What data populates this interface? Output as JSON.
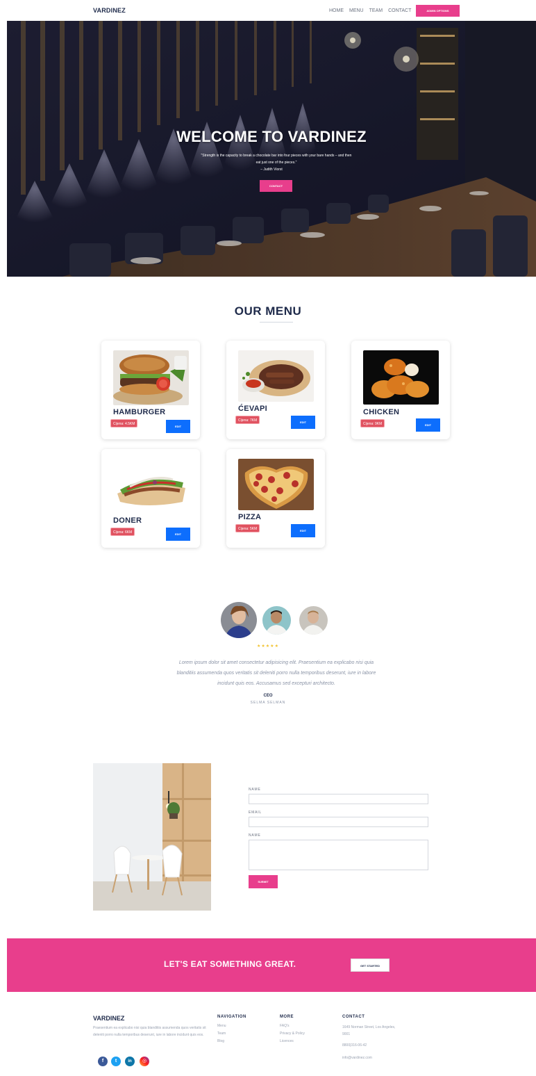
{
  "nav": {
    "brand": "VARDINEZ",
    "links": [
      "HOME",
      "MENU",
      "TEAM",
      "CONTACT"
    ],
    "admin_label": "ADMIN OPTIONS"
  },
  "hero": {
    "title": "WELCOME TO VARDINEZ",
    "quote": "\"Strength is the capacity to break a chocolate bar into four pieces with your bare hands – and then eat just one of the pieces.\"",
    "author": "– Judith Viorst",
    "button": "CONTACT"
  },
  "menu": {
    "title": "OUR MENU",
    "items": [
      {
        "name": "HAMBURGER",
        "price": "Cijena: 4.5KM",
        "edit": "EDIT"
      },
      {
        "name": "ĆEVAPI",
        "price": "Cijena: 7KM",
        "edit": "EDIT"
      },
      {
        "name": "CHICKEN",
        "price": "Cijena: 9KM",
        "edit": "EDIT"
      },
      {
        "name": "DONER",
        "price": "Cijena: 6KM",
        "edit": "EDIT"
      },
      {
        "name": "PIZZA",
        "price": "Cijena: 5KM",
        "edit": "EDIT"
      }
    ]
  },
  "testimonial": {
    "stars": "★★★★★",
    "text": "Lorem ipsum dolor sit amet consectetur adipisicing elit. Praesentium ea explicabo nisi quia blanditiis assumenda quos veritatis sit deleniti porro nulla temporibus deserunt, iure in labore incidunt quis eos. Accusamus sed excepturi architecto.",
    "role": "CEO",
    "name": "SELMA SELMAN"
  },
  "contact": {
    "label_name": "NAME",
    "label_email": "EMAIL",
    "label_message": "NAME",
    "submit": "SUBMIT"
  },
  "cta": {
    "text": "LET'S EAT SOMETHING GREAT.",
    "button": "GET STARTED"
  },
  "footer": {
    "brand": "VARDINEZ",
    "description": "Praesentium ea explicabo nisi quia blanditiis assumenda quos veritatis sit deleniti porro nulla temporibus deserunt, iure in labore incidunt quis eos.",
    "nav_head": "NAVIGATION",
    "nav_links": [
      "Menu",
      "Team",
      "Blog"
    ],
    "more_head": "MORE",
    "more_links": [
      "FAQ's",
      "Privacy & Policy",
      "Licences"
    ],
    "contact_head": "CONTACT",
    "address": "1649 Norman Street, Los Angeles, 9001",
    "phone": "8800|316-06-42",
    "email": "info@vardinez.com",
    "social": [
      {
        "icon": "facebook-icon",
        "glyph": "f",
        "color": "#3b5998"
      },
      {
        "icon": "twitter-icon",
        "glyph": "t",
        "color": "#1da1f2"
      },
      {
        "icon": "linkedin-icon",
        "glyph": "in",
        "color": "#0e76a8"
      },
      {
        "icon": "instagram-icon",
        "glyph": "◎",
        "color": "#d6249f"
      }
    ]
  },
  "colors": {
    "accent": "#e83e8c",
    "primary": "#0d6efd",
    "navy": "#1e2a4a",
    "price_red": "#e05260"
  }
}
